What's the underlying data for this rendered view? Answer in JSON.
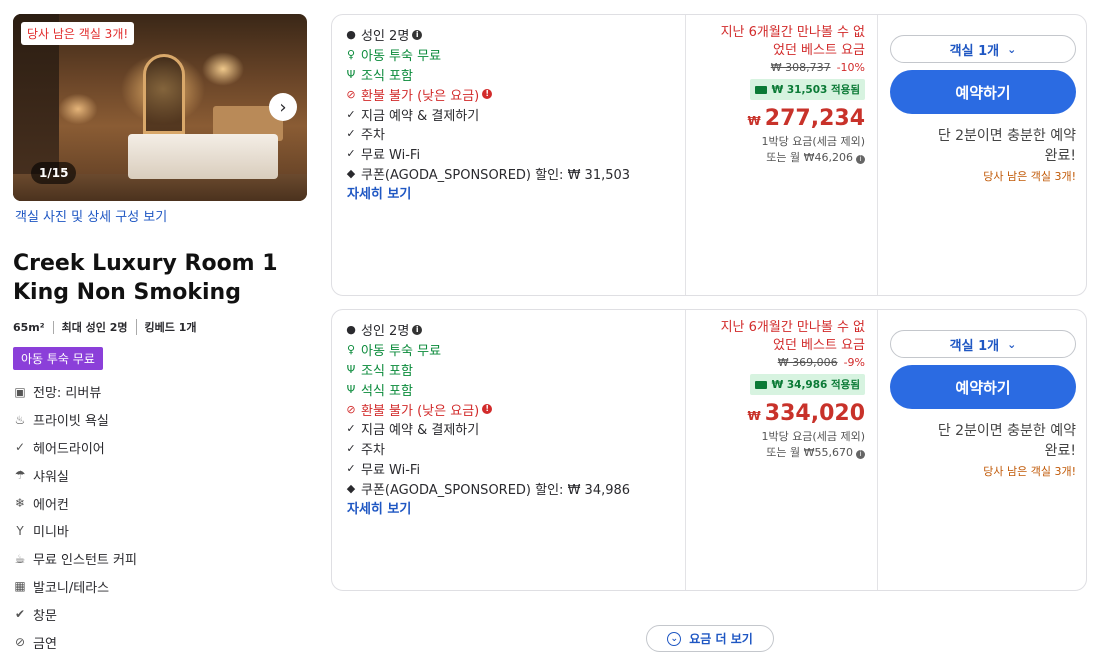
{
  "room": {
    "photo_badge": "당사 남은 객실 3개!",
    "photo_counter": "1/15",
    "photo_link": "객실 사진 및 상세 구성 보기",
    "title_line1": "Creek Luxury Room 1",
    "title_line2": "King Non Smoking",
    "meta": [
      "65m²",
      "최대 성인 2명",
      "킹베드 1개"
    ],
    "kids_badge": "아동 투숙 무료",
    "amenities": [
      {
        "icon": "view-icon",
        "glyph": "▣",
        "label": "전망: 리버뷰"
      },
      {
        "icon": "bathtub-icon",
        "glyph": "♨",
        "label": "프라이빗 욕실"
      },
      {
        "icon": "check-icon",
        "glyph": "✓",
        "label": "헤어드라이어"
      },
      {
        "icon": "shower-icon",
        "glyph": "☂",
        "label": "샤워실"
      },
      {
        "icon": "snowflake-icon",
        "glyph": "❄",
        "label": "에어컨"
      },
      {
        "icon": "cocktail-icon",
        "glyph": "Y",
        "label": "미니바"
      },
      {
        "icon": "coffee-icon",
        "glyph": "☕",
        "label": "무료 인스턴트 커피"
      },
      {
        "icon": "balcony-icon",
        "glyph": "▦",
        "label": "발코니/테라스"
      },
      {
        "icon": "window-icon",
        "glyph": "✔",
        "label": "창문"
      },
      {
        "icon": "no-smoking-icon",
        "glyph": "⊘",
        "label": "금연"
      }
    ]
  },
  "offers": [
    {
      "guests": "성인 2명",
      "features": [
        {
          "type": "green",
          "icon": "child-icon",
          "glyph": "♀",
          "label": "아동 투숙 무료"
        },
        {
          "type": "green",
          "icon": "utensils-icon",
          "glyph": "Ψ",
          "label": "조식 포함"
        },
        {
          "type": "red",
          "icon": "no-refund-icon",
          "glyph": "⊘",
          "label": "환불 불가 (낮은 요금)",
          "info": true
        },
        {
          "type": "normal",
          "icon": "check-icon",
          "glyph": "✓",
          "label": "지금 예약 & 결제하기"
        },
        {
          "type": "normal",
          "icon": "check-icon",
          "glyph": "✓",
          "label": "주차"
        },
        {
          "type": "normal",
          "icon": "check-icon",
          "glyph": "✓",
          "label": "무료 Wi-Fi"
        },
        {
          "type": "normal",
          "icon": "tag-icon",
          "glyph": "◆",
          "label": "쿠폰(AGODA_SPONSORED) 할인: ₩ 31,503"
        }
      ],
      "details_link": "자세히 보기",
      "best_line1": "지난 6개월간 만나볼 수 없",
      "best_line2": "었던 베스트 요금",
      "original_price": "₩ 308,737",
      "discount_pct": "-10%",
      "coupon_applied": "₩ 31,503 적용됨",
      "currency": "₩",
      "price": "277,234",
      "per_night": "1박당 요금(세금 제외)",
      "monthly": "또는 월 ₩46,206",
      "room_select": "객실 1개",
      "book_label": "예약하기",
      "quick_line1": "단 2분이면 충분한 예약",
      "quick_line2": "완료!",
      "rooms_left": "당사 남은 객실 3개!"
    },
    {
      "guests": "성인 2명",
      "features": [
        {
          "type": "green",
          "icon": "child-icon",
          "glyph": "♀",
          "label": "아동 투숙 무료"
        },
        {
          "type": "green",
          "icon": "utensils-icon",
          "glyph": "Ψ",
          "label": "조식 포함"
        },
        {
          "type": "green",
          "icon": "utensils-icon",
          "glyph": "Ψ",
          "label": "석식 포함"
        },
        {
          "type": "red",
          "icon": "no-refund-icon",
          "glyph": "⊘",
          "label": "환불 불가 (낮은 요금)",
          "info": true
        },
        {
          "type": "normal",
          "icon": "check-icon",
          "glyph": "✓",
          "label": "지금 예약 & 결제하기"
        },
        {
          "type": "normal",
          "icon": "check-icon",
          "glyph": "✓",
          "label": "주차"
        },
        {
          "type": "normal",
          "icon": "check-icon",
          "glyph": "✓",
          "label": "무료 Wi-Fi"
        },
        {
          "type": "normal",
          "icon": "tag-icon",
          "glyph": "◆",
          "label": "쿠폰(AGODA_SPONSORED) 할인: ₩ 34,986"
        }
      ],
      "details_link": "자세히 보기",
      "best_line1": "지난 6개월간 만나볼 수 없",
      "best_line2": "었던 베스트 요금",
      "original_price": "₩ 369,006",
      "discount_pct": "-9%",
      "coupon_applied": "₩ 34,986 적용됨",
      "currency": "₩",
      "price": "334,020",
      "per_night": "1박당 요금(세금 제외)",
      "monthly": "또는 월 ₩55,670",
      "room_select": "객실 1개",
      "book_label": "예약하기",
      "quick_line1": "단 2분이면 충분한 예약",
      "quick_line2": "완료!",
      "rooms_left": "당사 남은 객실 3개!"
    }
  ],
  "more_rates": "요금 더 보기",
  "colors": {
    "primary": "#2b6be2",
    "link": "#1f57c3",
    "price": "#c8322a",
    "green": "#0a8a3a",
    "purple": "#8b3fd9"
  }
}
